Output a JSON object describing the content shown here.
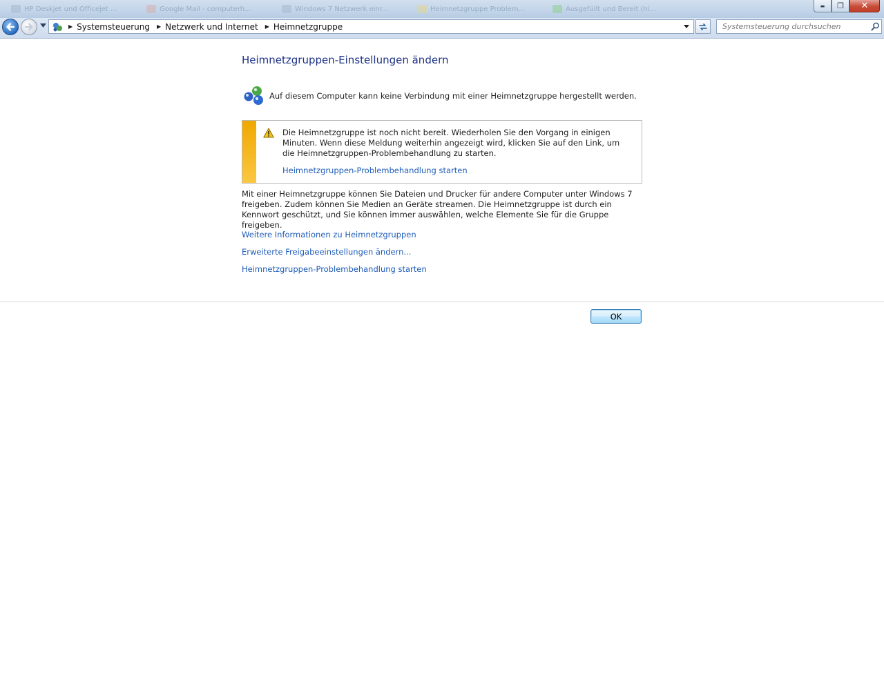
{
  "window": {
    "taskbar_tabs": [
      "HP Deskjet und Officejet ...",
      "Google Mail - computerh...",
      "Windows 7 Netzwerk einr...",
      "Heimnetzgruppe Problem...",
      "Ausgefüllt und Bereit (hi..."
    ],
    "buttons": {
      "minimize": "▬",
      "restore": "❐",
      "close": "✕"
    }
  },
  "address_bar": {
    "breadcrumbs": [
      "Systemsteuerung",
      "Netzwerk und Internet",
      "Heimnetzgruppe"
    ]
  },
  "search": {
    "placeholder": "Systemsteuerung durchsuchen"
  },
  "main": {
    "heading": "Heimnetzgruppen-Einstellungen ändern",
    "status_text": "Auf diesem Computer kann keine Verbindung mit einer Heimnetzgruppe hergestellt werden.",
    "warning": {
      "message": "Die Heimnetzgruppe ist noch nicht bereit. Wiederholen Sie den Vorgang in einigen Minuten. Wenn diese Meldung weiterhin angezeigt wird, klicken Sie auf den Link, um die Heimnetzgruppen-Problembehandlung zu starten.",
      "link": "Heimnetzgruppen-Problembehandlung starten"
    },
    "description": "Mit einer Heimnetzgruppe können Sie Dateien und Drucker für andere Computer unter Windows 7 freigeben. Zudem können Sie Medien an Geräte streamen. Die Heimnetzgruppe ist durch ein Kennwort geschützt, und Sie können immer auswählen, welche Elemente Sie für die Gruppe freigeben.",
    "links": [
      "Weitere Informationen zu Heimnetzgruppen",
      "Erweiterte Freigabeeinstellungen ändern...",
      "Heimnetzgruppen-Problembehandlung starten"
    ]
  },
  "footer": {
    "ok_label": "OK"
  },
  "colors": {
    "heading": "#1e3287",
    "link": "#1d5bb8",
    "warning_stripe": "#f0a800"
  }
}
